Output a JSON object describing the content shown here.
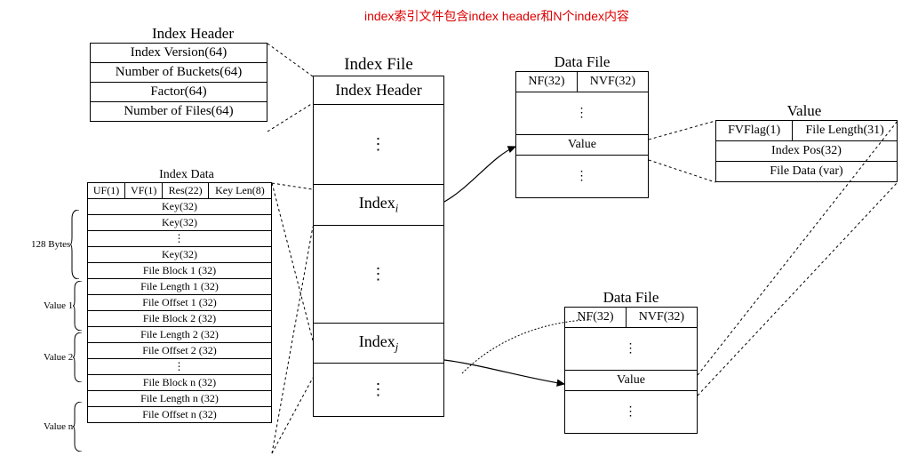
{
  "annotation": "index索引文件包含index header和N个index内容",
  "indexHeader": {
    "title": "Index Header",
    "rows": [
      "Index Version(64)",
      "Number of Buckets(64)",
      "Factor(64)",
      "Number of Files(64)"
    ]
  },
  "indexData": {
    "title": "Index Data",
    "headerRow": [
      "UF(1)",
      "VF(1)",
      "Res(22)",
      "Key Len(8)"
    ],
    "keyRows": [
      "Key(32)",
      "Key(32)",
      "⋮",
      "Key(32)"
    ],
    "value1": [
      "File Block 1 (32)",
      "File Length 1 (32)",
      "File Offset 1 (32)"
    ],
    "value2": [
      "File Block 2 (32)",
      "File Length 2 (32)",
      "File Offset 2 (32)"
    ],
    "midDots": "⋮",
    "valueN": [
      "File Block n (32)",
      "File Length n (32)",
      "File Offset n (32)"
    ]
  },
  "brackets": {
    "bytes": "128 Bytes",
    "v1": "Value 1",
    "v2": "Value 2",
    "vn": "Value n"
  },
  "indexFile": {
    "title": "Index File",
    "rows": [
      "Index Header",
      "⋮",
      "Index_i",
      "⋮",
      "Index_j",
      "⋮"
    ]
  },
  "dataFile1": {
    "title": "Data File",
    "header": [
      "NF(32)",
      "NVF(32)"
    ],
    "rows": [
      "⋮",
      "Value",
      "⋮"
    ]
  },
  "dataFile2": {
    "title": "Data File",
    "header": [
      "NF(32)",
      "NVF(32)"
    ],
    "rows": [
      "⋮",
      "Value",
      "⋮"
    ]
  },
  "valueBox": {
    "title": "Value",
    "headerRow": [
      "FVFlag(1)",
      "File Length(31)"
    ],
    "rows": [
      "Index Pos(32)",
      "File Data (var)"
    ]
  }
}
